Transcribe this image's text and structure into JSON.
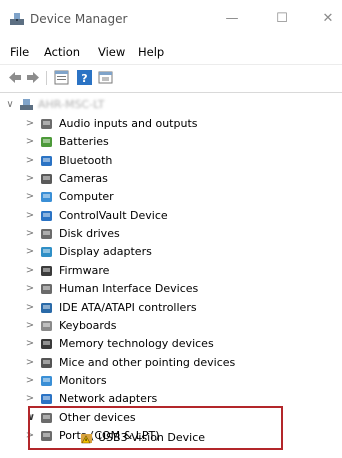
{
  "window": {
    "title": "Device Manager",
    "minimize_glyph": "—",
    "maximize_glyph": "☐",
    "close_glyph": "✕"
  },
  "menu": [
    "File",
    "Action",
    "View",
    "Help"
  ],
  "toolbar": {
    "buttons": [
      "back-arrow-icon",
      "forward-arrow-icon",
      "properties-icon",
      "help-icon",
      "scan-hardware-icon"
    ]
  },
  "tree": {
    "computer_name": "AHR-MSC-LT",
    "expand_glyph": ">",
    "collapse_glyph": "∨",
    "categories": [
      "Audio inputs and outputs",
      "Batteries",
      "Bluetooth",
      "Cameras",
      "Computer",
      "ControlVault Device",
      "Disk drives",
      "Display adapters",
      "Firmware",
      "Human Interface Devices",
      "IDE ATA/ATAPI controllers",
      "Keyboards",
      "Memory technology devices",
      "Mice and other pointing devices",
      "Monitors",
      "Network adapters",
      "Other devices",
      "Ports (COM & LPT)"
    ],
    "other_devices_child": "USB3 Vision Device"
  },
  "colors": {
    "highlight_border": "#b3262a",
    "icon_blue": "#2b73c4"
  }
}
